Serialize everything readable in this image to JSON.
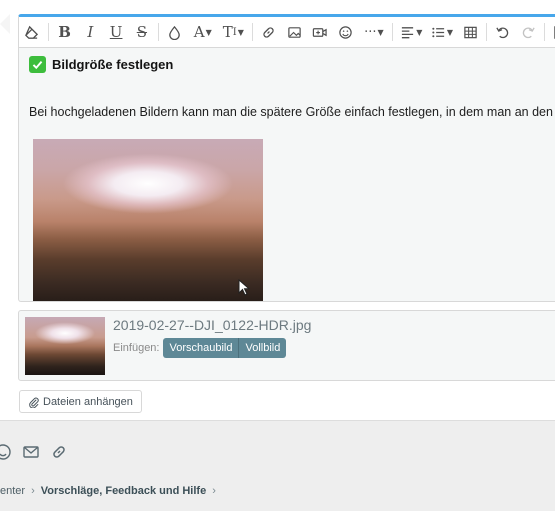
{
  "toolbar": {
    "buttons": [
      {
        "name": "remove-format-icon"
      },
      {
        "name": "bold-icon",
        "glyph": "B"
      },
      {
        "name": "italic-icon",
        "glyph": "I"
      },
      {
        "name": "underline-icon",
        "glyph": "U"
      },
      {
        "name": "strikethrough-icon",
        "glyph": "S"
      },
      {
        "name": "text-color-icon"
      },
      {
        "name": "font-family-icon",
        "glyph": "A"
      },
      {
        "name": "font-size-icon",
        "glyph": "T"
      },
      {
        "name": "link-icon"
      },
      {
        "name": "image-icon"
      },
      {
        "name": "media-icon"
      },
      {
        "name": "smilie-icon"
      },
      {
        "name": "more-icon"
      },
      {
        "name": "align-icon"
      },
      {
        "name": "list-icon"
      },
      {
        "name": "table-icon"
      },
      {
        "name": "undo-icon"
      },
      {
        "name": "redo-icon"
      },
      {
        "name": "drafts-icon"
      }
    ],
    "accent_color": "#47a7eb"
  },
  "content": {
    "heading": "Bildgröße festlegen",
    "paragraph": "Bei hochgeladenen Bildern kann man die spätere Größe einfach festlegen, in dem man an den Eck"
  },
  "attachment": {
    "filename": "2019-02-27--DJI_0122-HDR.jpg",
    "insert_label": "Einfügen:",
    "thumbnail_button": "Vorschaubild",
    "full_button": "Vollbild",
    "button_color": "#5e8896"
  },
  "attach_files_button": "Dateien anhängen",
  "breadcrumb": {
    "items": [
      "enter",
      "Vorschläge, Feedback und Hilfe"
    ],
    "separator": "›"
  }
}
